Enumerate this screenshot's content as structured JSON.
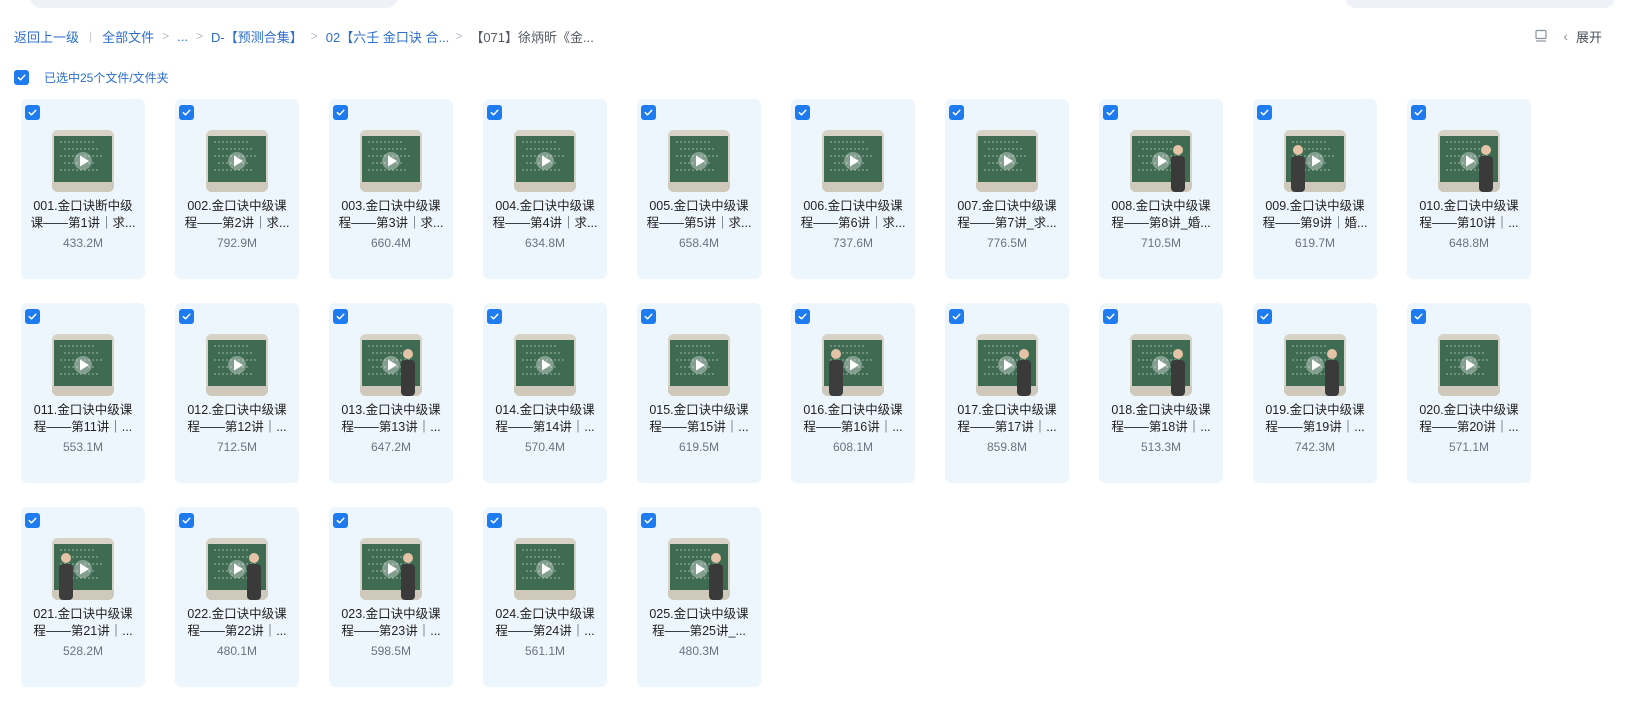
{
  "breadcrumb": {
    "back": "返回上一级",
    "all_files": "全部文件",
    "ellipsis": "...",
    "folder1": "D-【预测合集】",
    "folder2": "02【六壬 金口诀 合...",
    "current": "【071】徐炳昕《金..."
  },
  "toolbar": {
    "expand": "展开"
  },
  "selection": {
    "text": "已选中25个文件/文件夹"
  },
  "icons": {
    "checkbox": "checkbox-checked-icon",
    "play": "play-icon",
    "layout": "layout-icon",
    "chevron": "chevron-left-icon"
  },
  "colors": {
    "accent": "#1e7bf0",
    "link": "#2c6fcd",
    "card_bg": "#eef6fd",
    "board": "#3f6b52"
  },
  "files": [
    {
      "name": "001.金口诀断中级课——第1讲｜求...",
      "size": "433.2M",
      "person": "none"
    },
    {
      "name": "002.金口诀中级课程——第2讲｜求...",
      "size": "792.9M",
      "person": "none"
    },
    {
      "name": "003.金口诀中级课程——第3讲｜求...",
      "size": "660.4M",
      "person": "none"
    },
    {
      "name": "004.金口诀中级课程——第4讲｜求...",
      "size": "634.8M",
      "person": "none"
    },
    {
      "name": "005.金口诀中级课程——第5讲｜求...",
      "size": "658.4M",
      "person": "none"
    },
    {
      "name": "006.金口诀中级课程——第6讲｜求...",
      "size": "737.6M",
      "person": "none"
    },
    {
      "name": "007.金口诀中级课程——第7讲_求...",
      "size": "776.5M",
      "person": "none"
    },
    {
      "name": "008.金口诀中级课程——第8讲_婚...",
      "size": "710.5M",
      "person": "right"
    },
    {
      "name": "009.金口诀中级课程——第9讲｜婚...",
      "size": "619.7M",
      "person": "left"
    },
    {
      "name": "010.金口诀中级课程——第10讲｜...",
      "size": "648.8M",
      "person": "right"
    },
    {
      "name": "011.金口诀中级课程——第11讲｜...",
      "size": "553.1M",
      "person": "none"
    },
    {
      "name": "012.金口诀中级课程——第12讲｜...",
      "size": "712.5M",
      "person": "none"
    },
    {
      "name": "013.金口诀中级课程——第13讲｜...",
      "size": "647.2M",
      "person": "right"
    },
    {
      "name": "014.金口诀中级课程——第14讲｜...",
      "size": "570.4M",
      "person": "none"
    },
    {
      "name": "015.金口诀中级课程——第15讲｜...",
      "size": "619.5M",
      "person": "none"
    },
    {
      "name": "016.金口诀中级课程——第16讲｜...",
      "size": "608.1M",
      "person": "left"
    },
    {
      "name": "017.金口诀中级课程——第17讲｜...",
      "size": "859.8M",
      "person": "right"
    },
    {
      "name": "018.金口诀中级课程——第18讲｜...",
      "size": "513.3M",
      "person": "right"
    },
    {
      "name": "019.金口诀中级课程——第19讲｜...",
      "size": "742.3M",
      "person": "right"
    },
    {
      "name": "020.金口诀中级课程——第20讲｜...",
      "size": "571.1M",
      "person": "none"
    },
    {
      "name": "021.金口诀中级课程——第21讲｜...",
      "size": "528.2M",
      "person": "left"
    },
    {
      "name": "022.金口诀中级课程——第22讲｜...",
      "size": "480.1M",
      "person": "right"
    },
    {
      "name": "023.金口诀中级课程——第23讲｜...",
      "size": "598.5M",
      "person": "right"
    },
    {
      "name": "024.金口诀中级课程——第24讲｜...",
      "size": "561.1M",
      "person": "none"
    },
    {
      "name": "025.金口诀中级课程——第25讲_...",
      "size": "480.3M",
      "person": "right"
    }
  ]
}
